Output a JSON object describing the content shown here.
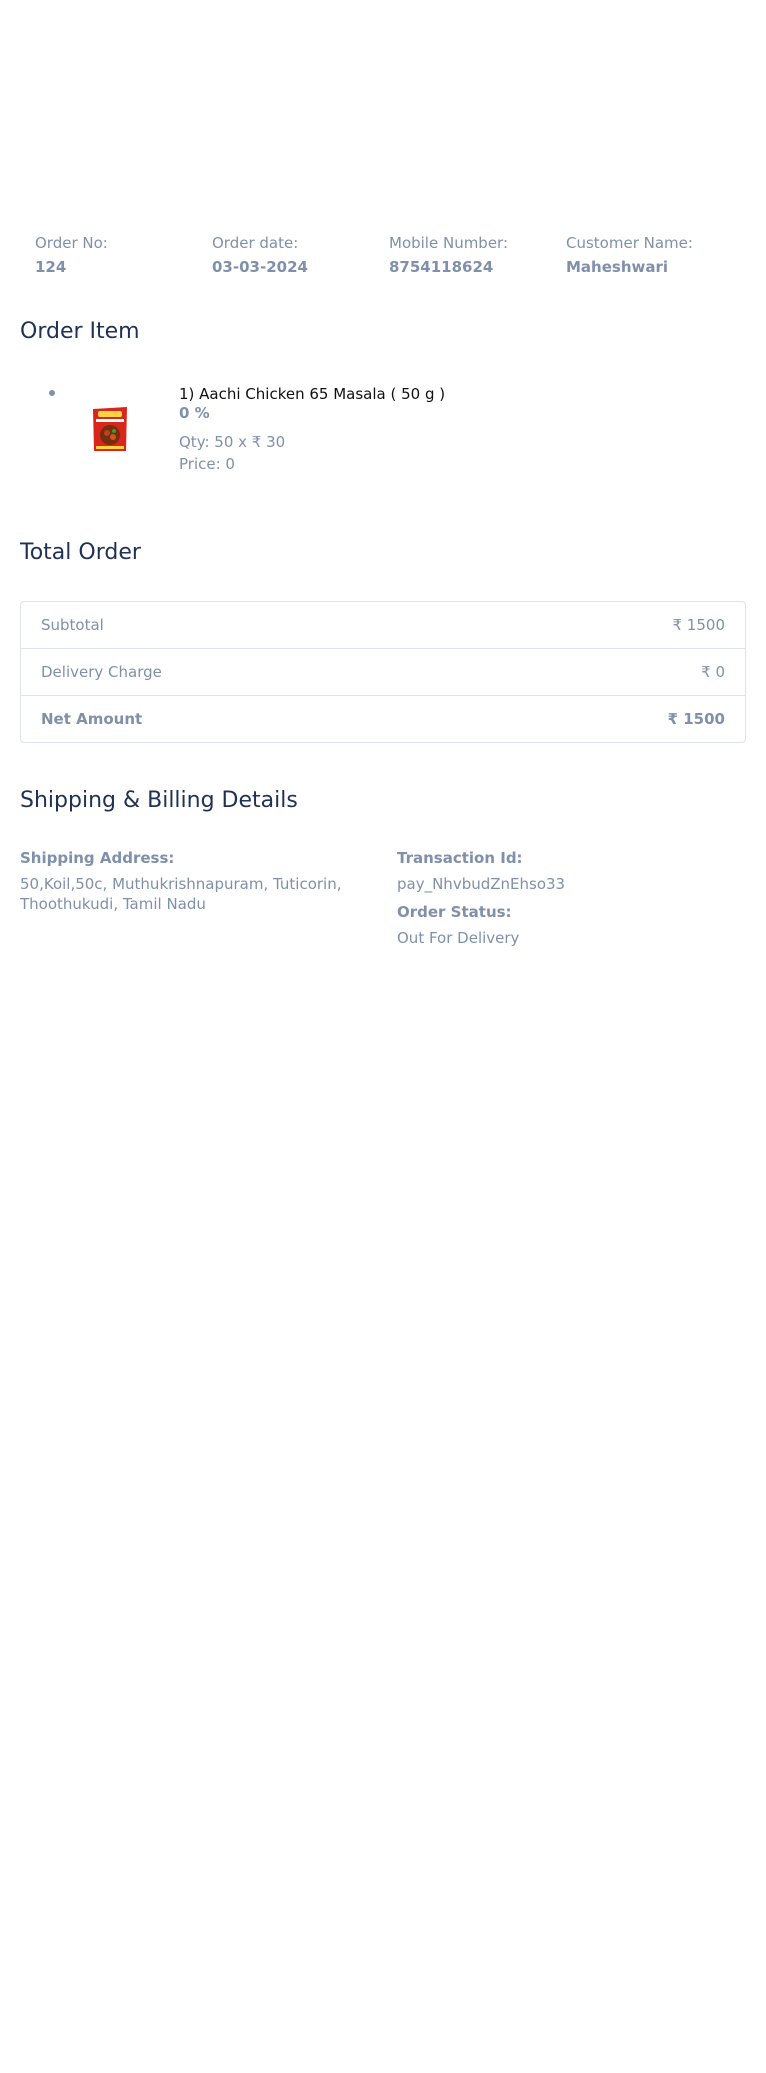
{
  "order_meta": {
    "order_no_label": "Order No:",
    "order_no": "124",
    "order_date_label": "Order date:",
    "order_date": "03-03-2024",
    "mobile_label": "Mobile Number:",
    "mobile": "8754118624",
    "customer_label": "Customer Name:",
    "customer": "Maheshwari"
  },
  "order_item": {
    "title": "Order Item",
    "items": [
      {
        "name": "1) Aachi Chicken 65 Masala ( 50 g )",
        "discount": "0 %",
        "qty": "Qty: 50 x ₹ 30",
        "price": "Price: 0",
        "image_icon": "product-package-icon"
      }
    ]
  },
  "total_order": {
    "title": "Total Order",
    "rows": [
      {
        "label": "Subtotal",
        "value": "₹ 1500"
      },
      {
        "label": "Delivery Charge",
        "value": "₹ 0"
      },
      {
        "label": "Net Amount",
        "value": "₹ 1500"
      }
    ]
  },
  "shipping": {
    "title": "Shipping & Billing Details",
    "address_label": "Shipping Address:",
    "address": "50,Koil,50c, Muthukrishnapuram, Tuticorin, Thoothukudi, Tamil Nadu",
    "transaction_label": "Transaction Id:",
    "transaction_id": "pay_NhvbudZnEhso33",
    "status_label": "Order Status:",
    "status": "Out For Delivery"
  },
  "colors": {
    "heading": "#1f3154",
    "muted": "#8090ab",
    "border": "#dfe3ea",
    "product_red": "#d9261c"
  }
}
